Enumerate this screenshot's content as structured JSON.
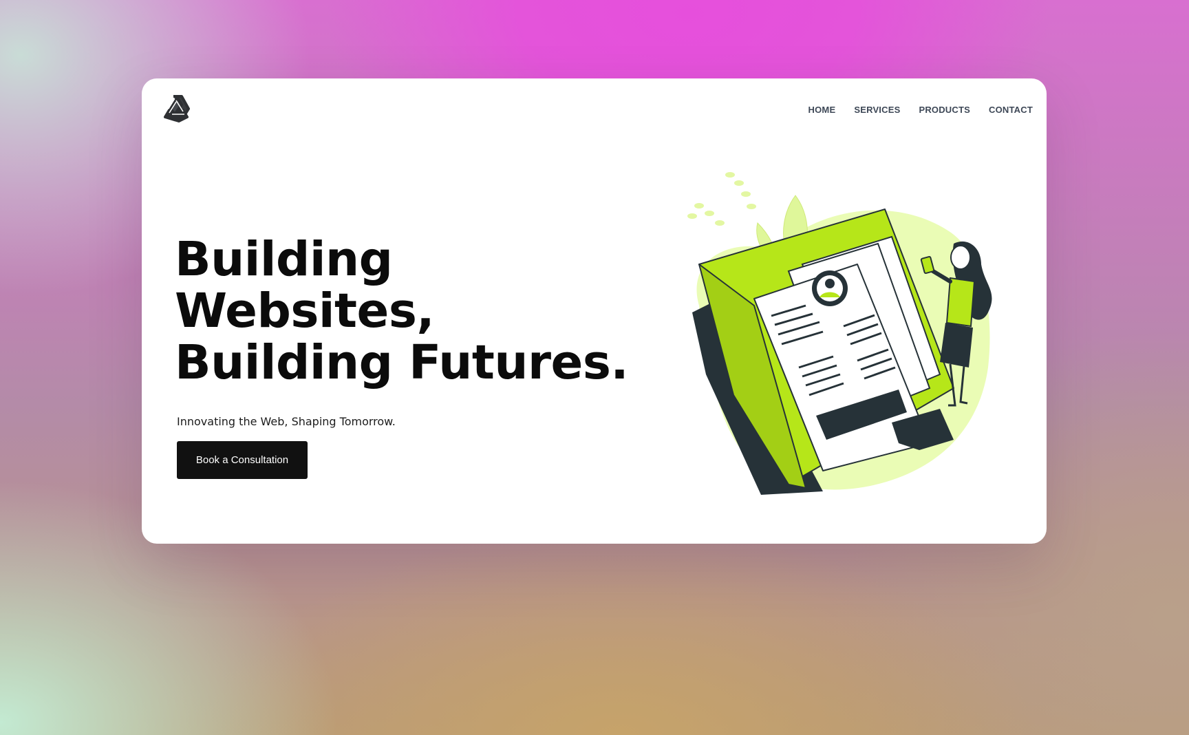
{
  "nav": {
    "items": [
      {
        "label": "HOME"
      },
      {
        "label": "SERVICES"
      },
      {
        "label": "PRODUCTS"
      },
      {
        "label": "CONTACT"
      }
    ]
  },
  "hero": {
    "headline_lines": [
      "Building",
      "Websites,",
      "Building Futures."
    ],
    "subtitle": "Innovating the Web, Shaping Tomorrow.",
    "cta_label": "Book a Consultation"
  },
  "colors": {
    "accent": "#b6e619",
    "accent_light": "#e9fbb4",
    "dark": "#263238",
    "button": "#111111"
  },
  "icons": {
    "logo": "triangle-knot-logo",
    "illustration": "document-folder-illustration"
  }
}
